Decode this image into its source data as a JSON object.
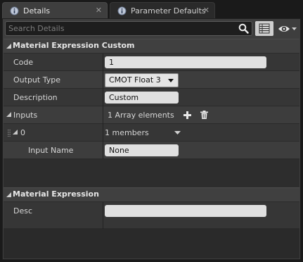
{
  "tabs": [
    {
      "label": "Details",
      "close": "✕"
    },
    {
      "label": "Parameter Defaults",
      "close": "✕"
    }
  ],
  "search": {
    "placeholder": "Search Details"
  },
  "categories": {
    "custom": {
      "title": "Material Expression Custom",
      "code": {
        "label": "Code",
        "value": "1"
      },
      "output_type": {
        "label": "Output Type",
        "value": "CMOT Float 3"
      },
      "description": {
        "label": "Description",
        "value": "Custom"
      },
      "inputs": {
        "label": "Inputs",
        "value": "1 Array elements"
      },
      "input_0": {
        "label": "0",
        "value": "1 members"
      },
      "input_name": {
        "label": "Input Name",
        "value": "None"
      }
    },
    "expression": {
      "title": "Material Expression",
      "desc": {
        "label": "Desc",
        "value": ""
      }
    }
  },
  "colors": {
    "panel_bg": "#3e3e3e",
    "content_bg": "#2d2d2d",
    "category_bg": "#404040",
    "field_bg": "#e0e0e0"
  },
  "icons": {
    "details_tab": "info-icon",
    "parameter_tab": "info-icon",
    "search": "magnifier-icon",
    "grid": "property-matrix-icon",
    "eye": "eye-icon",
    "add": "plus-icon",
    "delete": "trash-icon"
  }
}
